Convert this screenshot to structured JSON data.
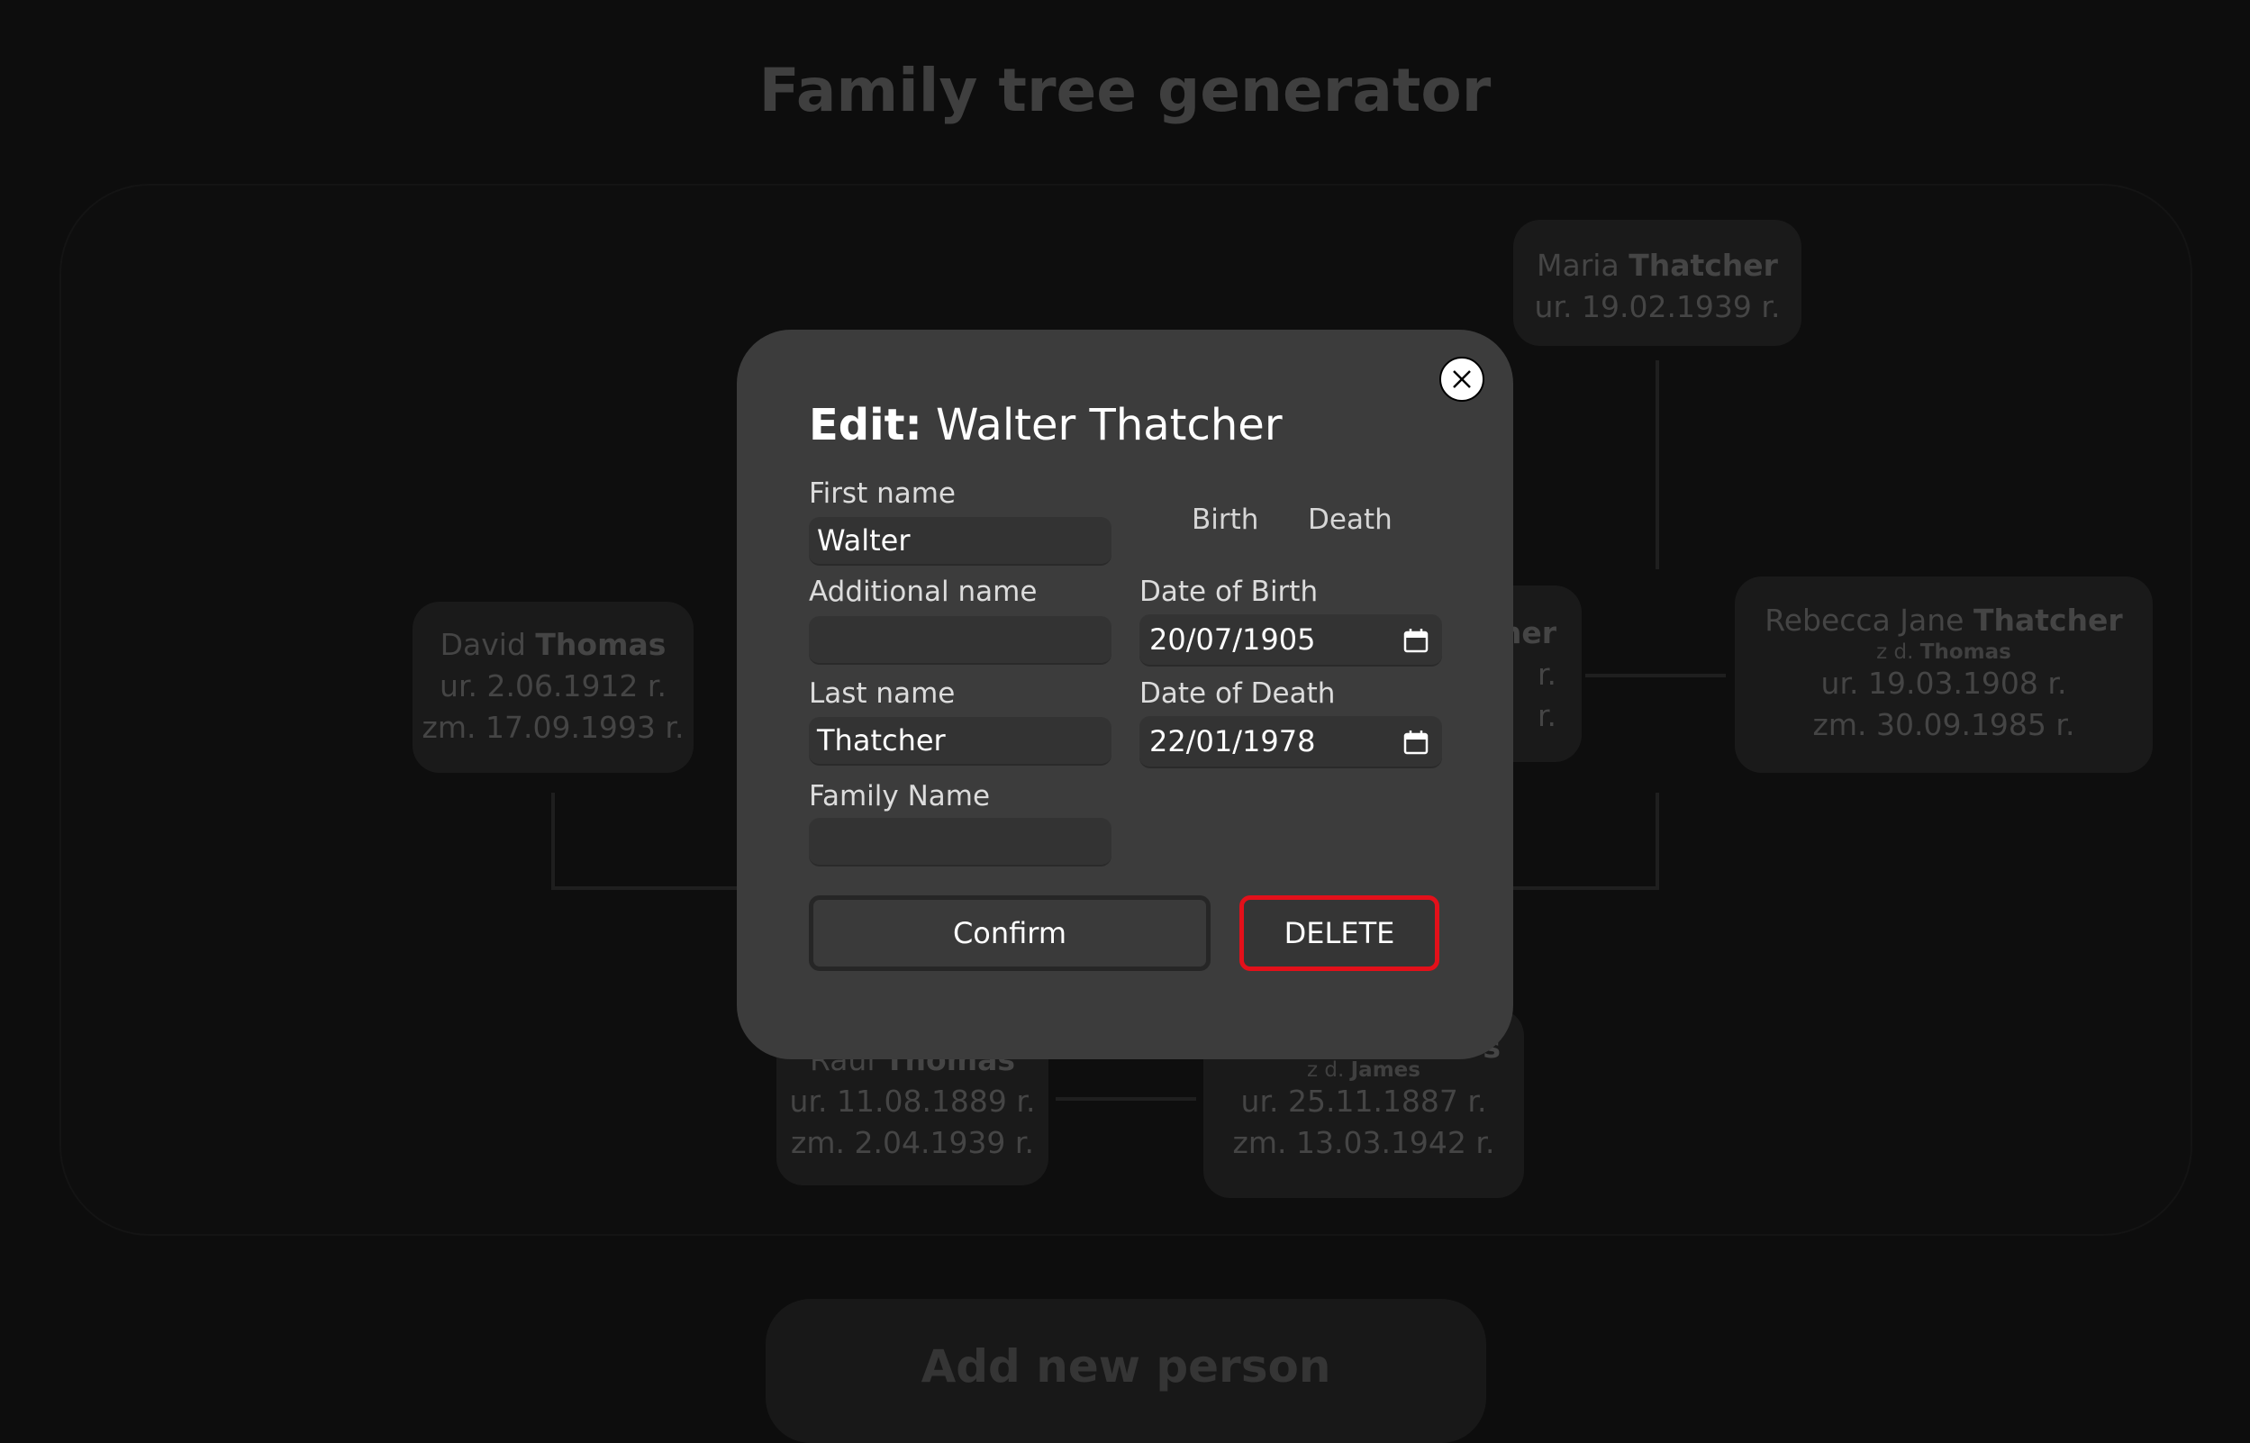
{
  "page": {
    "title": "Family tree generator",
    "add_person_label": "Add new person"
  },
  "tree": {
    "people": [
      {
        "first": "Maria",
        "last": "Thatcher",
        "maiden_prefix": "",
        "maiden": "",
        "born": "ur. 19.02.1939 r.",
        "died": ""
      },
      {
        "first": "David",
        "last": "Thomas",
        "maiden_prefix": "",
        "maiden": "",
        "born": "ur. 2.06.1912 r.",
        "died": "zm. 17.09.1993 r."
      },
      {
        "first": "",
        "last": "",
        "partial_text": "her",
        "born_tail": "r.",
        "died_tail": "r."
      },
      {
        "first": "Rebecca Jane",
        "last": "Thatcher",
        "maiden_prefix": "z d.",
        "maiden": "Thomas",
        "born": "ur. 19.03.1908 r.",
        "died": "zm. 30.09.1985 r."
      },
      {
        "first": "Raul",
        "last": "Thomas",
        "maiden_prefix": "",
        "maiden": "",
        "born": "ur. 11.08.1889 r.",
        "died": "zm. 2.04.1939 r."
      },
      {
        "first": "",
        "last": "",
        "partial_text": "s",
        "maiden_prefix": "z d.",
        "maiden": "James",
        "born": "ur. 25.11.1887 r.",
        "died": "zm. 13.03.1942 r."
      }
    ]
  },
  "modal": {
    "title_prefix": "Edit:",
    "title_name": "Walter Thatcher",
    "fields": {
      "first_name": {
        "label": "First name",
        "value": "Walter"
      },
      "additional_name": {
        "label": "Additional name",
        "value": ""
      },
      "last_name": {
        "label": "Last name",
        "value": "Thatcher"
      },
      "family_name": {
        "label": "Family Name",
        "value": ""
      }
    },
    "tabs": {
      "birth": "Birth",
      "death": "Death"
    },
    "dates": {
      "birth": {
        "label": "Date of Birth",
        "value": "20/07/1905"
      },
      "death": {
        "label": "Date of Death",
        "value": "22/01/1978"
      }
    },
    "buttons": {
      "confirm": "Confirm",
      "delete": "DELETE"
    }
  },
  "icons": {
    "close": "close-icon",
    "calendar": "calendar-icon"
  },
  "colors": {
    "delete_border": "#e3101a",
    "modal_bg": "#3c3c3c",
    "page_bg": "#0d0d0d"
  }
}
